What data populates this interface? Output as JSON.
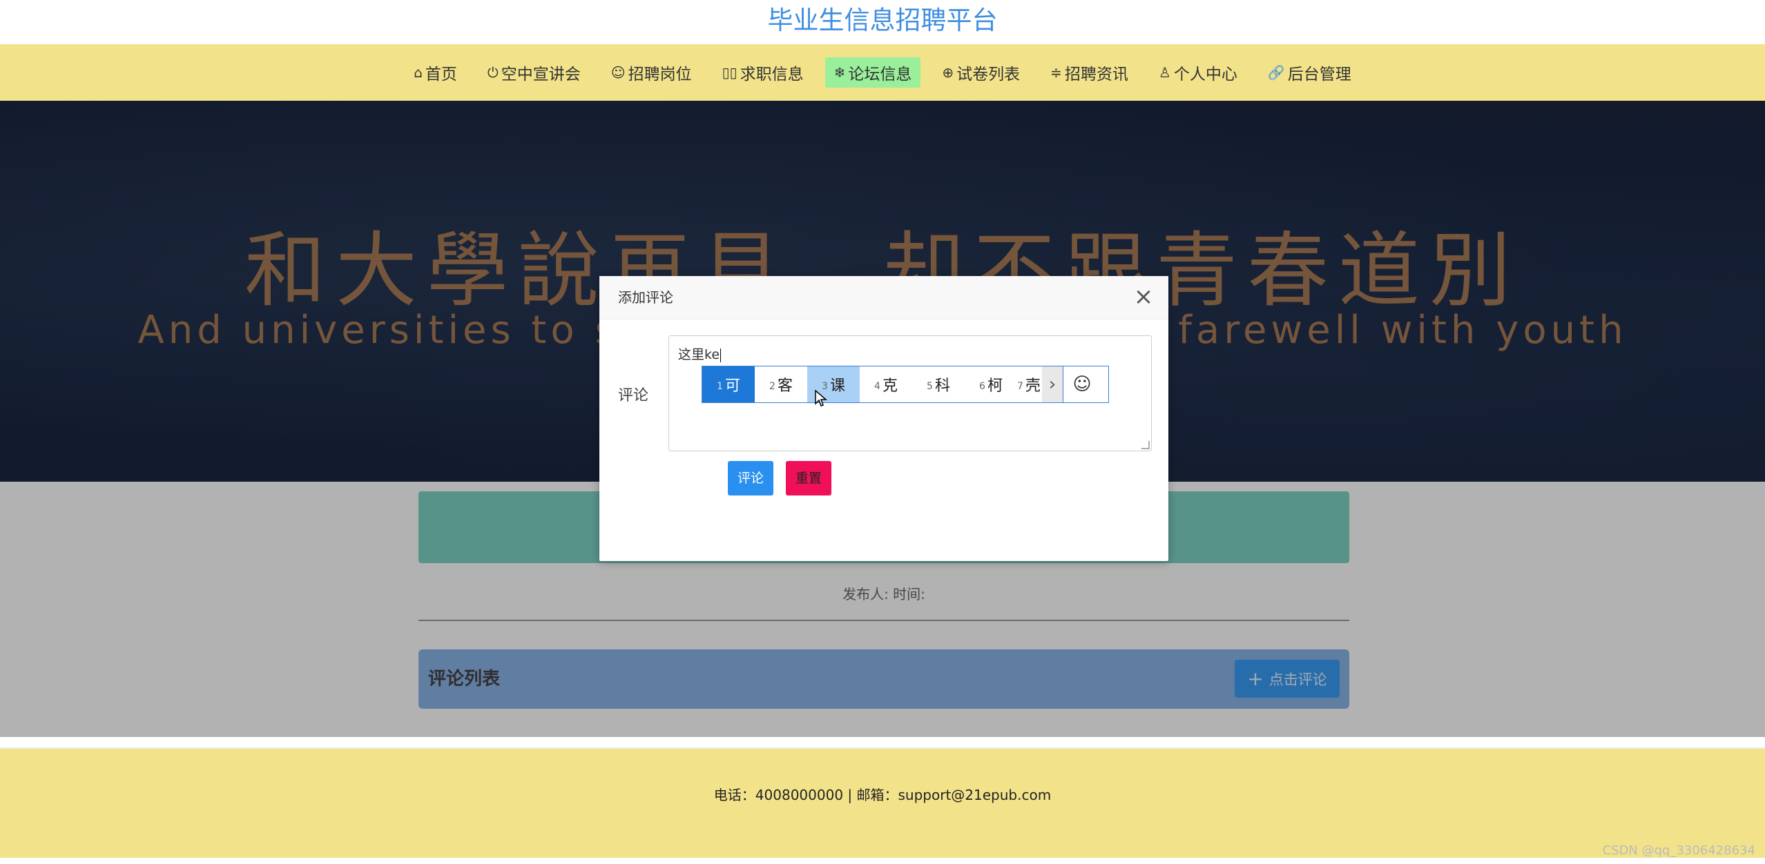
{
  "header": {
    "title": "毕业生信息招聘平台"
  },
  "nav": {
    "items": [
      {
        "icon": "home-icon",
        "glyph": "⌂",
        "label": "首页"
      },
      {
        "icon": "power-icon",
        "glyph": "⏻",
        "label": "空中宣讲会"
      },
      {
        "icon": "face-icon",
        "glyph": "☺",
        "label": "招聘岗位"
      },
      {
        "icon": "columns-icon",
        "glyph": "▯▯",
        "label": "求职信息"
      },
      {
        "icon": "snowflake-icon",
        "glyph": "❄",
        "label": "论坛信息"
      },
      {
        "icon": "globe-icon",
        "glyph": "⊕",
        "label": "试卷列表"
      },
      {
        "icon": "sliders-icon",
        "glyph": "≑",
        "label": "招聘资讯"
      },
      {
        "icon": "user-icon",
        "glyph": "♙",
        "label": "个人中心"
      },
      {
        "icon": "link-icon",
        "glyph": "🔗",
        "label": "后台管理"
      }
    ],
    "active_index": 4,
    "active_color": "#9af09a"
  },
  "banner": {
    "headline": "和大學說再見，却不跟青春道別",
    "subline": "And universities to say goodbye, but do not farewell with youth"
  },
  "post": {
    "meta": "发布人:  时间:"
  },
  "comments": {
    "title": "评论列表",
    "add_button": "点击评论",
    "add_icon": "plus-icon"
  },
  "footer": {
    "contact": "电话：4008000000 | 邮箱：support@21epub.com"
  },
  "watermark": "CSDN @qq_3306428634",
  "modal": {
    "title": "添加评论",
    "close_glyph": "×",
    "field_label": "评论",
    "textarea_value": "这里ke",
    "submit_label": "评论",
    "reset_label": "重置"
  },
  "ime": {
    "candidates": [
      {
        "n": "1",
        "text": "可"
      },
      {
        "n": "2",
        "text": "客"
      },
      {
        "n": "3",
        "text": "课"
      },
      {
        "n": "4",
        "text": "克"
      },
      {
        "n": "5",
        "text": "科"
      },
      {
        "n": "6",
        "text": "柯"
      },
      {
        "n": "7",
        "text": "壳"
      }
    ],
    "selected_index": 0,
    "hover_index": 2,
    "next_glyph": "›",
    "emoji_glyph": "☺"
  },
  "colors": {
    "title_blue": "#3f8fe0",
    "nav_yellow": "#f2e38a",
    "submit_blue": "#2a90f0",
    "reset_red": "#f0105a"
  }
}
